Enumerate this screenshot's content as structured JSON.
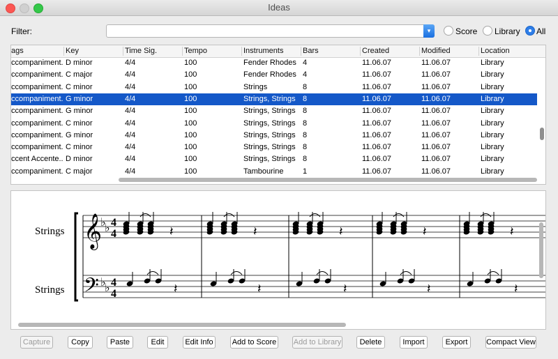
{
  "window": {
    "title": "Ideas"
  },
  "filter": {
    "label": "Filter:",
    "value": "",
    "options": [
      {
        "label": "Score",
        "selected": false
      },
      {
        "label": "Library",
        "selected": false
      },
      {
        "label": "All",
        "selected": true
      }
    ]
  },
  "table": {
    "columns": [
      "ags",
      "Key",
      "Time Sig.",
      "Tempo",
      "Instruments",
      "Bars",
      "Created",
      "Modified",
      "Location"
    ],
    "rows": [
      {
        "tags": "ccompaniment...",
        "key": "D minor",
        "timesig": "4/4",
        "tempo": "100",
        "instruments": "Fender Rhodes",
        "bars": "4",
        "created": "11.06.07",
        "modified": "11.06.07",
        "location": "Library",
        "selected": false
      },
      {
        "tags": "ccompaniment...",
        "key": "C major",
        "timesig": "4/4",
        "tempo": "100",
        "instruments": "Fender Rhodes",
        "bars": "4",
        "created": "11.06.07",
        "modified": "11.06.07",
        "location": "Library",
        "selected": false
      },
      {
        "tags": "ccompaniment...",
        "key": "C minor",
        "timesig": "4/4",
        "tempo": "100",
        "instruments": "Strings",
        "bars": "8",
        "created": "11.06.07",
        "modified": "11.06.07",
        "location": "Library",
        "selected": false
      },
      {
        "tags": "ccompaniment...",
        "key": "G minor",
        "timesig": "4/4",
        "tempo": "100",
        "instruments": "Strings, Strings",
        "bars": "8",
        "created": "11.06.07",
        "modified": "11.06.07",
        "location": "Library",
        "selected": true
      },
      {
        "tags": "ccompaniment...",
        "key": "G minor",
        "timesig": "4/4",
        "tempo": "100",
        "instruments": "Strings, Strings",
        "bars": "8",
        "created": "11.06.07",
        "modified": "11.06.07",
        "location": "Library",
        "selected": false
      },
      {
        "tags": "ccompaniment...",
        "key": "C minor",
        "timesig": "4/4",
        "tempo": "100",
        "instruments": "Strings, Strings",
        "bars": "8",
        "created": "11.06.07",
        "modified": "11.06.07",
        "location": "Library",
        "selected": false
      },
      {
        "tags": "ccompaniment...",
        "key": "G minor",
        "timesig": "4/4",
        "tempo": "100",
        "instruments": "Strings, Strings",
        "bars": "8",
        "created": "11.06.07",
        "modified": "11.06.07",
        "location": "Library",
        "selected": false
      },
      {
        "tags": "ccompaniment...",
        "key": "C minor",
        "timesig": "4/4",
        "tempo": "100",
        "instruments": "Strings, Strings",
        "bars": "8",
        "created": "11.06.07",
        "modified": "11.06.07",
        "location": "Library",
        "selected": false
      },
      {
        "tags": "ccent Accente...",
        "key": "D minor",
        "timesig": "4/4",
        "tempo": "100",
        "instruments": "Strings, Strings",
        "bars": "8",
        "created": "11.06.07",
        "modified": "11.06.07",
        "location": "Library",
        "selected": false
      },
      {
        "tags": "ccompaniment...",
        "key": "C major",
        "timesig": "4/4",
        "tempo": "100",
        "instruments": "Tambourine",
        "bars": "1",
        "created": "11.06.07",
        "modified": "11.06.07",
        "location": "Library",
        "selected": false
      }
    ]
  },
  "score": {
    "staff1_label": "Strings",
    "staff2_label": "Strings",
    "time_sig_top": "4",
    "time_sig_bottom": "4"
  },
  "buttons": [
    {
      "label": "Capture",
      "enabled": false
    },
    {
      "label": "Copy",
      "enabled": true
    },
    {
      "label": "Paste",
      "enabled": true
    },
    {
      "label": "Edit",
      "enabled": true
    },
    {
      "label": "Edit Info",
      "enabled": true
    },
    {
      "label": "Add to Score",
      "enabled": true
    },
    {
      "label": "Add to Library",
      "enabled": false
    },
    {
      "label": "Delete",
      "enabled": true
    },
    {
      "label": "Import",
      "enabled": true
    },
    {
      "label": "Export",
      "enabled": true
    },
    {
      "label": "Compact View",
      "enabled": true
    }
  ],
  "colors": {
    "selection": "#1458c8",
    "accent": "#2e7ee8"
  }
}
